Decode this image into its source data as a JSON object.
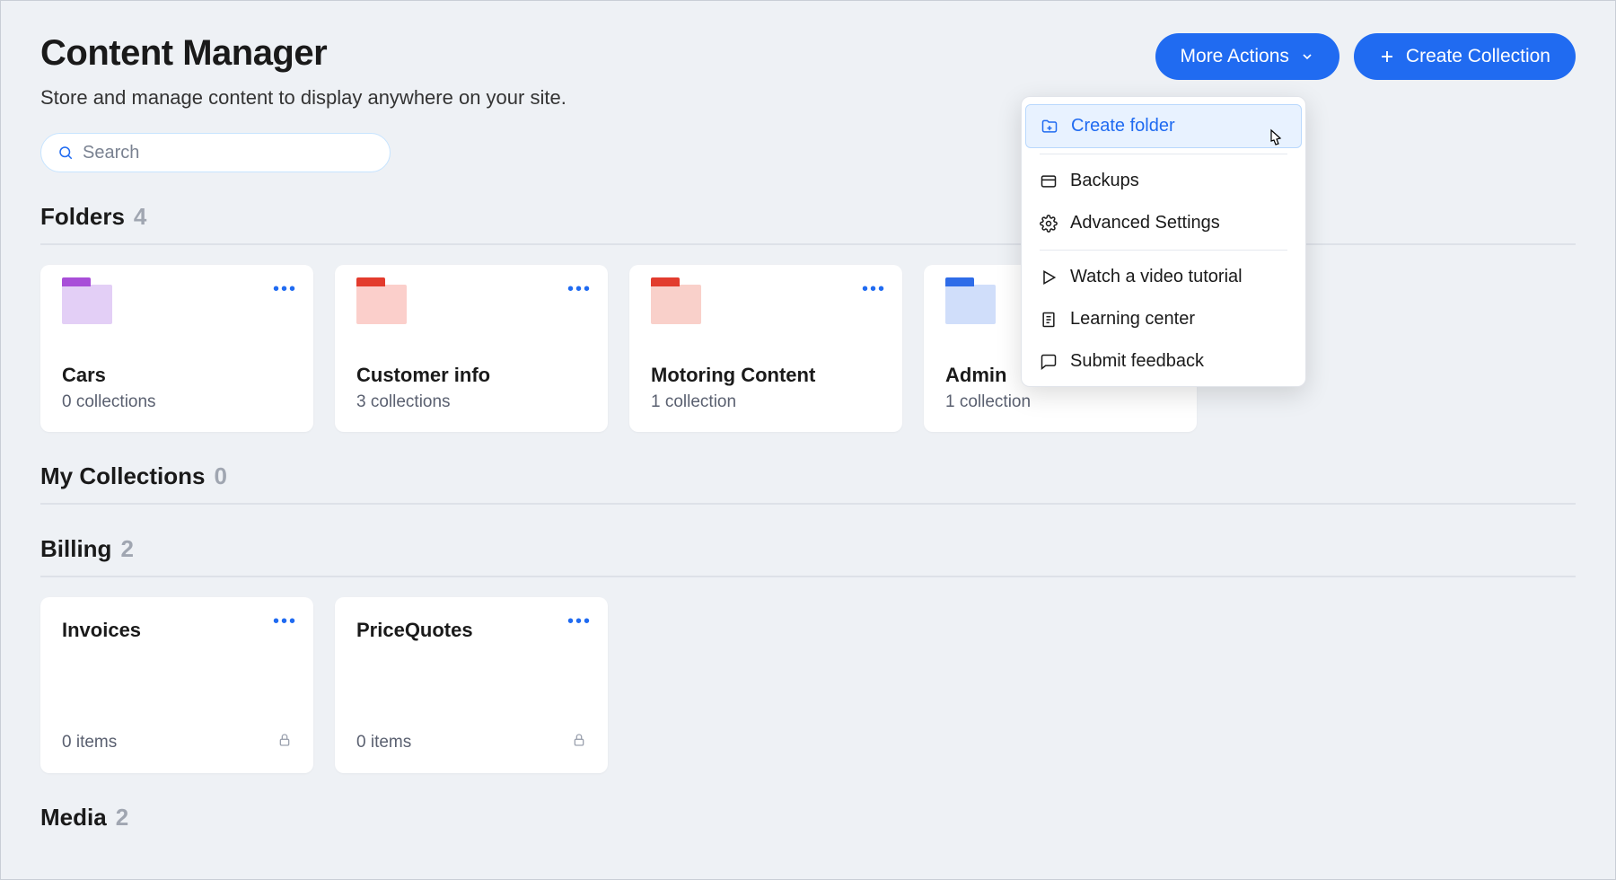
{
  "header": {
    "title": "Content Manager",
    "subtitle": "Store and manage content to display anywhere on your site.",
    "search_placeholder": "Search"
  },
  "actions": {
    "more_label": "More Actions",
    "create_label": "Create Collection"
  },
  "dropdown": {
    "create_folder": "Create folder",
    "backups": "Backups",
    "advanced": "Advanced Settings",
    "tutorial": "Watch a video tutorial",
    "learning": "Learning center",
    "feedback": "Submit feedback"
  },
  "sections": {
    "folders": {
      "title": "Folders",
      "count": "4"
    },
    "my_collections": {
      "title": "My Collections",
      "count": "0"
    },
    "billing": {
      "title": "Billing",
      "count": "2"
    },
    "media": {
      "title": "Media",
      "count": "2"
    }
  },
  "folders": [
    {
      "name": "Cars",
      "sub": "0 collections"
    },
    {
      "name": "Customer info",
      "sub": "3 collections"
    },
    {
      "name": "Motoring Content",
      "sub": "1 collection"
    },
    {
      "name": "Admin",
      "sub": "1 collection"
    }
  ],
  "billing_items": [
    {
      "name": "Invoices",
      "sub": "0 items"
    },
    {
      "name": "PriceQuotes",
      "sub": "0 items"
    }
  ]
}
